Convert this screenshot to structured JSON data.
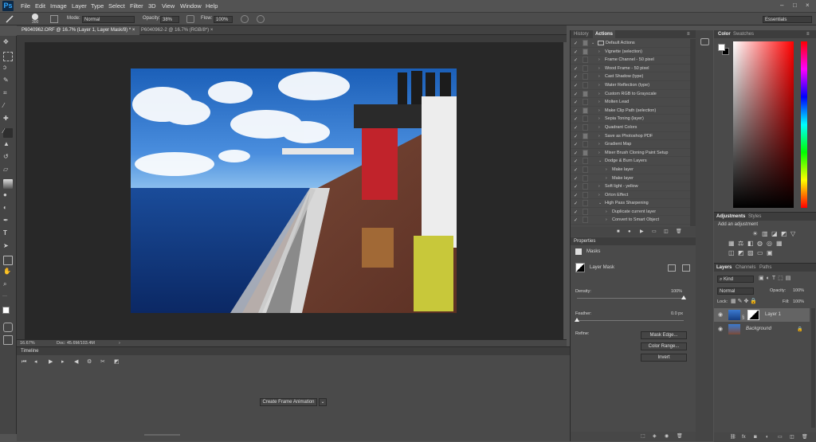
{
  "app": {
    "logo": "Ps"
  },
  "menu": [
    "File",
    "Edit",
    "Image",
    "Layer",
    "Type",
    "Select",
    "Filter",
    "3D",
    "View",
    "Window",
    "Help"
  ],
  "options": {
    "brush_size": "300",
    "mode_label": "Mode:",
    "mode_value": "Normal",
    "opacity_label": "Opacity:",
    "opacity_value": "38%",
    "flow_label": "Flow:",
    "flow_value": "100%",
    "workspace": "Essentials"
  },
  "tabs": [
    {
      "label": "P6040962.ORF @ 16.7% (Layer 1, Layer Mask/8) *"
    },
    {
      "label": "P6040962-2 @ 16.7% (RGB/8*)"
    }
  ],
  "status": {
    "zoom": "16.67%",
    "doc": "Doc: 45.6M/103.4M"
  },
  "timeline": {
    "title": "Timeline",
    "create_button": "Create Frame Animation"
  },
  "actions": {
    "tab_history": "History",
    "tab_actions": "Actions",
    "items": [
      {
        "label": "Default Actions",
        "level": 0,
        "open": true,
        "folder": true,
        "dlg": true
      },
      {
        "label": "Vignette (selection)",
        "level": 1,
        "dlg": true
      },
      {
        "label": "Frame Channel - 50 pixel",
        "level": 1,
        "dlg": false
      },
      {
        "label": "Wood Frame - 50 pixel",
        "level": 1,
        "dlg": false
      },
      {
        "label": "Cast Shadow (type)",
        "level": 1,
        "dlg": false
      },
      {
        "label": "Water Reflection (type)",
        "level": 1,
        "dlg": false
      },
      {
        "label": "Custom RGB to Grayscale",
        "level": 1,
        "dlg": true
      },
      {
        "label": "Molten Lead",
        "level": 1,
        "dlg": false
      },
      {
        "label": "Make Clip Path (selection)",
        "level": 1,
        "dlg": true
      },
      {
        "label": "Sepia Toning (layer)",
        "level": 1,
        "dlg": false
      },
      {
        "label": "Quadrant Colors",
        "level": 1,
        "dlg": false
      },
      {
        "label": "Save as Photoshop PDF",
        "level": 1,
        "dlg": true
      },
      {
        "label": "Gradient Map",
        "level": 1,
        "dlg": false
      },
      {
        "label": "Mixer Brush Cloning Paint Setup",
        "level": 1,
        "dlg": true
      },
      {
        "label": "Dodge & Burn Layers",
        "level": 1,
        "open": true,
        "dlg": false
      },
      {
        "label": "Make layer",
        "level": 2,
        "dlg": false
      },
      {
        "label": "Make layer",
        "level": 2,
        "dlg": false
      },
      {
        "label": "Soft light - yellow",
        "level": 1,
        "dlg": false
      },
      {
        "label": "Orton Effect",
        "level": 1,
        "dlg": false
      },
      {
        "label": "High Pass Sharpening",
        "level": 1,
        "open": true,
        "dlg": false
      },
      {
        "label": "Duplicate current layer",
        "level": 2,
        "dlg": false
      },
      {
        "label": "Convert to Smart Object",
        "level": 2,
        "dlg": false
      }
    ]
  },
  "properties": {
    "title": "Properties",
    "masks_label": "Masks",
    "layer_mask": "Layer Mask",
    "density_label": "Density:",
    "density_value": "100%",
    "density_level": 1.0,
    "feather_label": "Feather:",
    "feather_value": "0.0 px",
    "feather_level": 0.0,
    "refine_label": "Refine:",
    "mask_edge": "Mask Edge...",
    "color_range": "Color Range...",
    "invert": "Invert"
  },
  "color": {
    "tab_color": "Color",
    "tab_swatches": "Swatches",
    "hue": "#ff0000"
  },
  "adjustments": {
    "tab_adjustments": "Adjustments",
    "tab_styles": "Styles",
    "hint": "Add an adjustment"
  },
  "layers": {
    "tab_layers": "Layers",
    "tab_channels": "Channels",
    "tab_paths": "Paths",
    "kind": "Kind",
    "blend": "Normal",
    "opacity_label": "Opacity:",
    "opacity_value": "100%",
    "lock_label": "Lock:",
    "fill_label": "Fill:",
    "fill_value": "100%",
    "items": [
      {
        "name": "Layer 1",
        "selected": true,
        "mask": true
      },
      {
        "name": "Background",
        "selected": false,
        "locked": true
      }
    ]
  }
}
